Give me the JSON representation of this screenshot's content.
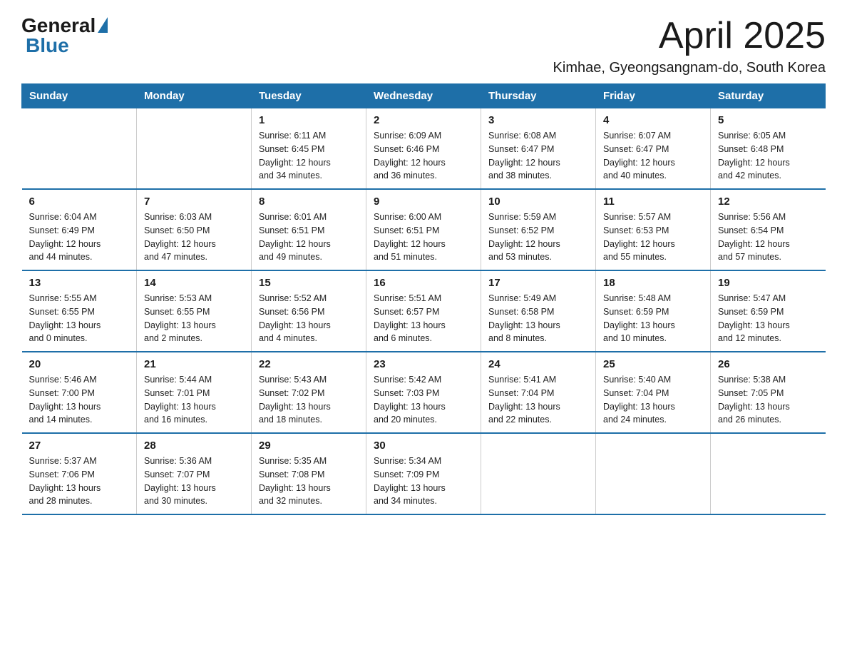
{
  "logo": {
    "general": "General",
    "blue": "Blue"
  },
  "title": {
    "month_year": "April 2025",
    "location": "Kimhae, Gyeongsangnam-do, South Korea"
  },
  "header": {
    "days": [
      "Sunday",
      "Monday",
      "Tuesday",
      "Wednesday",
      "Thursday",
      "Friday",
      "Saturday"
    ]
  },
  "weeks": [
    {
      "days": [
        {
          "number": "",
          "info": ""
        },
        {
          "number": "",
          "info": ""
        },
        {
          "number": "1",
          "info": "Sunrise: 6:11 AM\nSunset: 6:45 PM\nDaylight: 12 hours\nand 34 minutes."
        },
        {
          "number": "2",
          "info": "Sunrise: 6:09 AM\nSunset: 6:46 PM\nDaylight: 12 hours\nand 36 minutes."
        },
        {
          "number": "3",
          "info": "Sunrise: 6:08 AM\nSunset: 6:47 PM\nDaylight: 12 hours\nand 38 minutes."
        },
        {
          "number": "4",
          "info": "Sunrise: 6:07 AM\nSunset: 6:47 PM\nDaylight: 12 hours\nand 40 minutes."
        },
        {
          "number": "5",
          "info": "Sunrise: 6:05 AM\nSunset: 6:48 PM\nDaylight: 12 hours\nand 42 minutes."
        }
      ]
    },
    {
      "days": [
        {
          "number": "6",
          "info": "Sunrise: 6:04 AM\nSunset: 6:49 PM\nDaylight: 12 hours\nand 44 minutes."
        },
        {
          "number": "7",
          "info": "Sunrise: 6:03 AM\nSunset: 6:50 PM\nDaylight: 12 hours\nand 47 minutes."
        },
        {
          "number": "8",
          "info": "Sunrise: 6:01 AM\nSunset: 6:51 PM\nDaylight: 12 hours\nand 49 minutes."
        },
        {
          "number": "9",
          "info": "Sunrise: 6:00 AM\nSunset: 6:51 PM\nDaylight: 12 hours\nand 51 minutes."
        },
        {
          "number": "10",
          "info": "Sunrise: 5:59 AM\nSunset: 6:52 PM\nDaylight: 12 hours\nand 53 minutes."
        },
        {
          "number": "11",
          "info": "Sunrise: 5:57 AM\nSunset: 6:53 PM\nDaylight: 12 hours\nand 55 minutes."
        },
        {
          "number": "12",
          "info": "Sunrise: 5:56 AM\nSunset: 6:54 PM\nDaylight: 12 hours\nand 57 minutes."
        }
      ]
    },
    {
      "days": [
        {
          "number": "13",
          "info": "Sunrise: 5:55 AM\nSunset: 6:55 PM\nDaylight: 13 hours\nand 0 minutes."
        },
        {
          "number": "14",
          "info": "Sunrise: 5:53 AM\nSunset: 6:55 PM\nDaylight: 13 hours\nand 2 minutes."
        },
        {
          "number": "15",
          "info": "Sunrise: 5:52 AM\nSunset: 6:56 PM\nDaylight: 13 hours\nand 4 minutes."
        },
        {
          "number": "16",
          "info": "Sunrise: 5:51 AM\nSunset: 6:57 PM\nDaylight: 13 hours\nand 6 minutes."
        },
        {
          "number": "17",
          "info": "Sunrise: 5:49 AM\nSunset: 6:58 PM\nDaylight: 13 hours\nand 8 minutes."
        },
        {
          "number": "18",
          "info": "Sunrise: 5:48 AM\nSunset: 6:59 PM\nDaylight: 13 hours\nand 10 minutes."
        },
        {
          "number": "19",
          "info": "Sunrise: 5:47 AM\nSunset: 6:59 PM\nDaylight: 13 hours\nand 12 minutes."
        }
      ]
    },
    {
      "days": [
        {
          "number": "20",
          "info": "Sunrise: 5:46 AM\nSunset: 7:00 PM\nDaylight: 13 hours\nand 14 minutes."
        },
        {
          "number": "21",
          "info": "Sunrise: 5:44 AM\nSunset: 7:01 PM\nDaylight: 13 hours\nand 16 minutes."
        },
        {
          "number": "22",
          "info": "Sunrise: 5:43 AM\nSunset: 7:02 PM\nDaylight: 13 hours\nand 18 minutes."
        },
        {
          "number": "23",
          "info": "Sunrise: 5:42 AM\nSunset: 7:03 PM\nDaylight: 13 hours\nand 20 minutes."
        },
        {
          "number": "24",
          "info": "Sunrise: 5:41 AM\nSunset: 7:04 PM\nDaylight: 13 hours\nand 22 minutes."
        },
        {
          "number": "25",
          "info": "Sunrise: 5:40 AM\nSunset: 7:04 PM\nDaylight: 13 hours\nand 24 minutes."
        },
        {
          "number": "26",
          "info": "Sunrise: 5:38 AM\nSunset: 7:05 PM\nDaylight: 13 hours\nand 26 minutes."
        }
      ]
    },
    {
      "days": [
        {
          "number": "27",
          "info": "Sunrise: 5:37 AM\nSunset: 7:06 PM\nDaylight: 13 hours\nand 28 minutes."
        },
        {
          "number": "28",
          "info": "Sunrise: 5:36 AM\nSunset: 7:07 PM\nDaylight: 13 hours\nand 30 minutes."
        },
        {
          "number": "29",
          "info": "Sunrise: 5:35 AM\nSunset: 7:08 PM\nDaylight: 13 hours\nand 32 minutes."
        },
        {
          "number": "30",
          "info": "Sunrise: 5:34 AM\nSunset: 7:09 PM\nDaylight: 13 hours\nand 34 minutes."
        },
        {
          "number": "",
          "info": ""
        },
        {
          "number": "",
          "info": ""
        },
        {
          "number": "",
          "info": ""
        }
      ]
    }
  ]
}
